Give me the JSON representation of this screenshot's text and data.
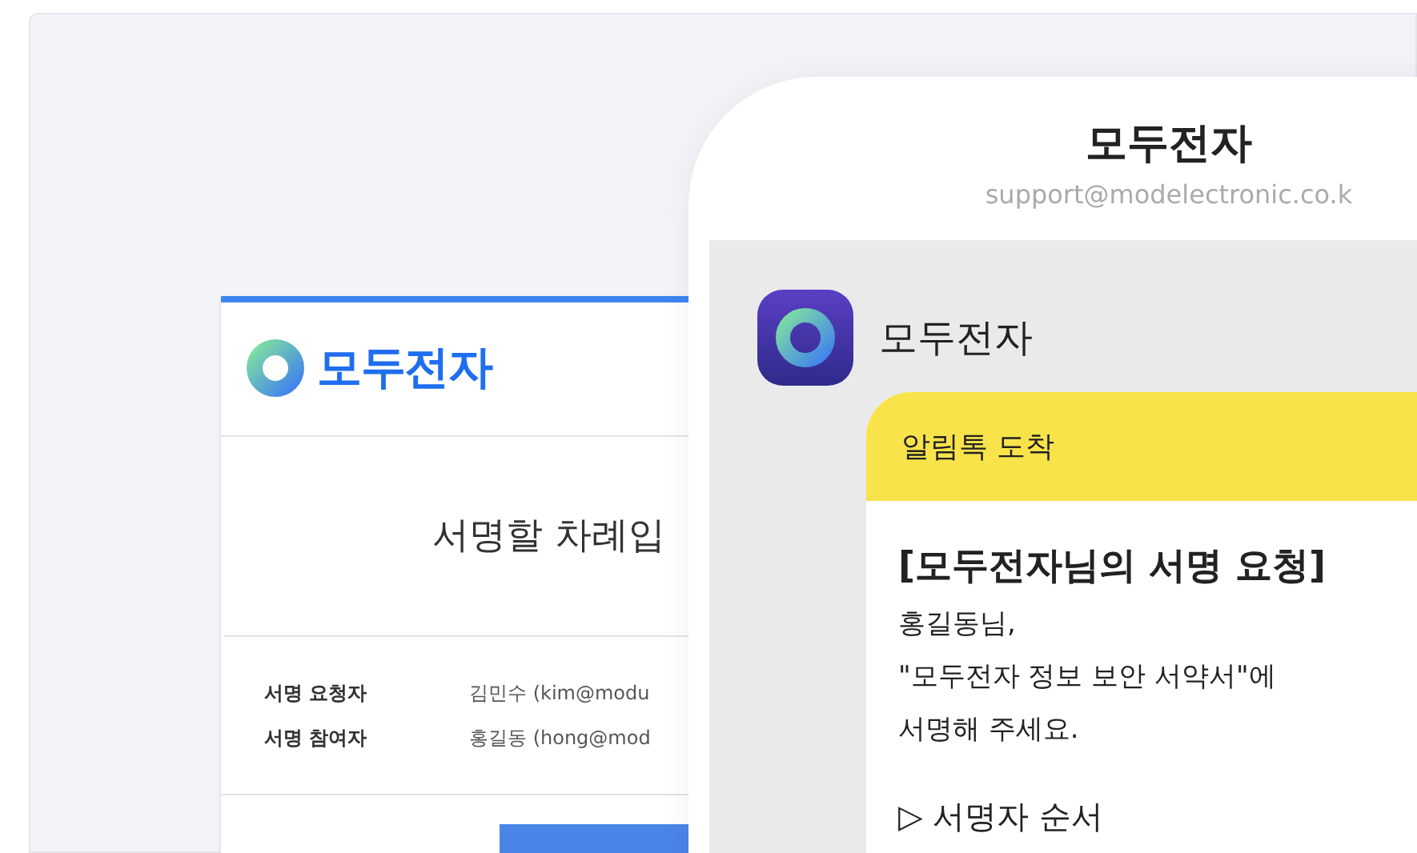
{
  "email_card": {
    "logo": "모두전자",
    "headline": "서명할 차례입",
    "rows": [
      {
        "label": "서명 요청자",
        "value": "김민수 (kim@modu"
      },
      {
        "label": "서명 참여자",
        "value": "홍길동 (hong@mod"
      }
    ]
  },
  "sender": {
    "name": "모두전자",
    "email": "support@modelectronic.co.k"
  },
  "chat": {
    "app_name": "모두전자",
    "message": {
      "header": "알림톡 도착",
      "title": "[모두전자님의 서명 요청]",
      "lines": [
        "홍길동님,",
        "\"모두전자 정보 보안 서약서\"에",
        "서명해 주세요."
      ],
      "section": "▷ 서명자 순서"
    }
  }
}
